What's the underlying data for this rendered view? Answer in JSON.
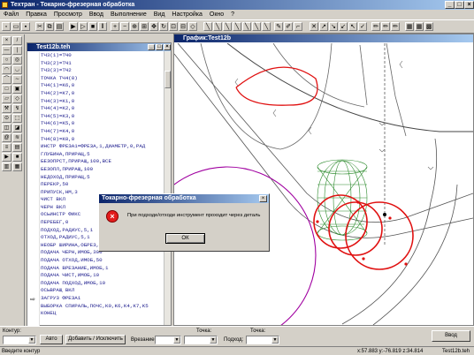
{
  "app": {
    "title": "Техтран - Токарно-фрезерная обработка"
  },
  "menu": [
    "Файл",
    "Правка",
    "Просмотр",
    "Ввод",
    "Выполнение",
    "Вид",
    "Настройка",
    "Окно",
    "?"
  ],
  "editor": {
    "title": "Test12b.teh",
    "lines": [
      "ТЧ3(1)=ТЧ0",
      "ТЧ3(2)=ТЧ1",
      "ТЧ3(3)=ТЧ2",
      "ТОЧКА ТЧ4(8)",
      "ТЧ4(1)=K6,0",
      "ТЧ4(2)=K7,0",
      "ТЧ4(3)=K1,0",
      "ТЧ4(4)=K2,0",
      "ТЧ4(5)=K3,0",
      "ТЧ4(6)=K5,0",
      "ТЧ4(7)=K4,0",
      "ТЧ4(8)=K0,0",
      "ИНСТР ФРЕЗА1=ФРЕЗА,1,ДИАМЕТР,0,РАД",
      "ГЛУБИНА,ПРИРАЩ,5",
      "БЕЗОПРСТ,ПРИРАЩ,100,ВСЕ",
      "БЕЗОПЛ,ПРИРАЩ,100",
      "НЕДОХОД,ПРИРАЩ,5",
      "ПЕРЕКР,50",
      "ПРИПУСК,НМ,3",
      "ЧИСТ ВКЛ",
      "ЧЕРН ВКЛ",
      "ОСЬИНСТР ФИКС",
      "ПЕРЕБЕГ,0",
      "ПОДХОД,РАДИУС,5,1",
      "ОТХОД,РАДИУС,5,1",
      "НЕОБР ШИРИНА,ОБРЕЗ,1",
      "ПОДАЧА ЧЕРН,ИМОБ,300",
      "ПОДАЧА ОТХОД,ИМОБ,50",
      "ПОДАЧА ВРЕЗАНИЕ,ИМОБ,1",
      "ПОДАЧА ЧИСТ,ИМОБ,10",
      "ПОДАЧА ПОДХОД,ИМОБ,10",
      "ОСЬВРАЩ ВКЛ",
      "ЗАГРУЗ ФРЕЗА1",
      "ВЫБОРКА СПИРАЛЬ,ПОЧС,K0,K6,K4,K7,K5",
      "КОНЕЦ"
    ]
  },
  "graphics": {
    "title": "График:Test12b"
  },
  "dialog": {
    "title": "Токарно-фрезерная обработка",
    "message": "При подходе/отходе инструмент проходит через деталь",
    "ok_label": "ОК",
    "close_label": "×"
  },
  "bottom": {
    "contour_label": "Контур:",
    "auto_label": "Авто",
    "add_exclude_label": "Добавить / Исключить",
    "point_a_label": "Точка:",
    "plunge_label": "Врезание:",
    "point_b_label": "Точка:",
    "approach_label": "Подход:",
    "enter_label": "Ввод"
  },
  "status": {
    "left": "Введите контур",
    "coords": "x:57.883 y:-76.819 z:34.814",
    "file": "Test12b.teh"
  },
  "colors": {
    "accent": "#0a246a",
    "toolpath": "#e01010",
    "tool_mesh": "#2c8a2c",
    "boundary": "#a000a0"
  }
}
